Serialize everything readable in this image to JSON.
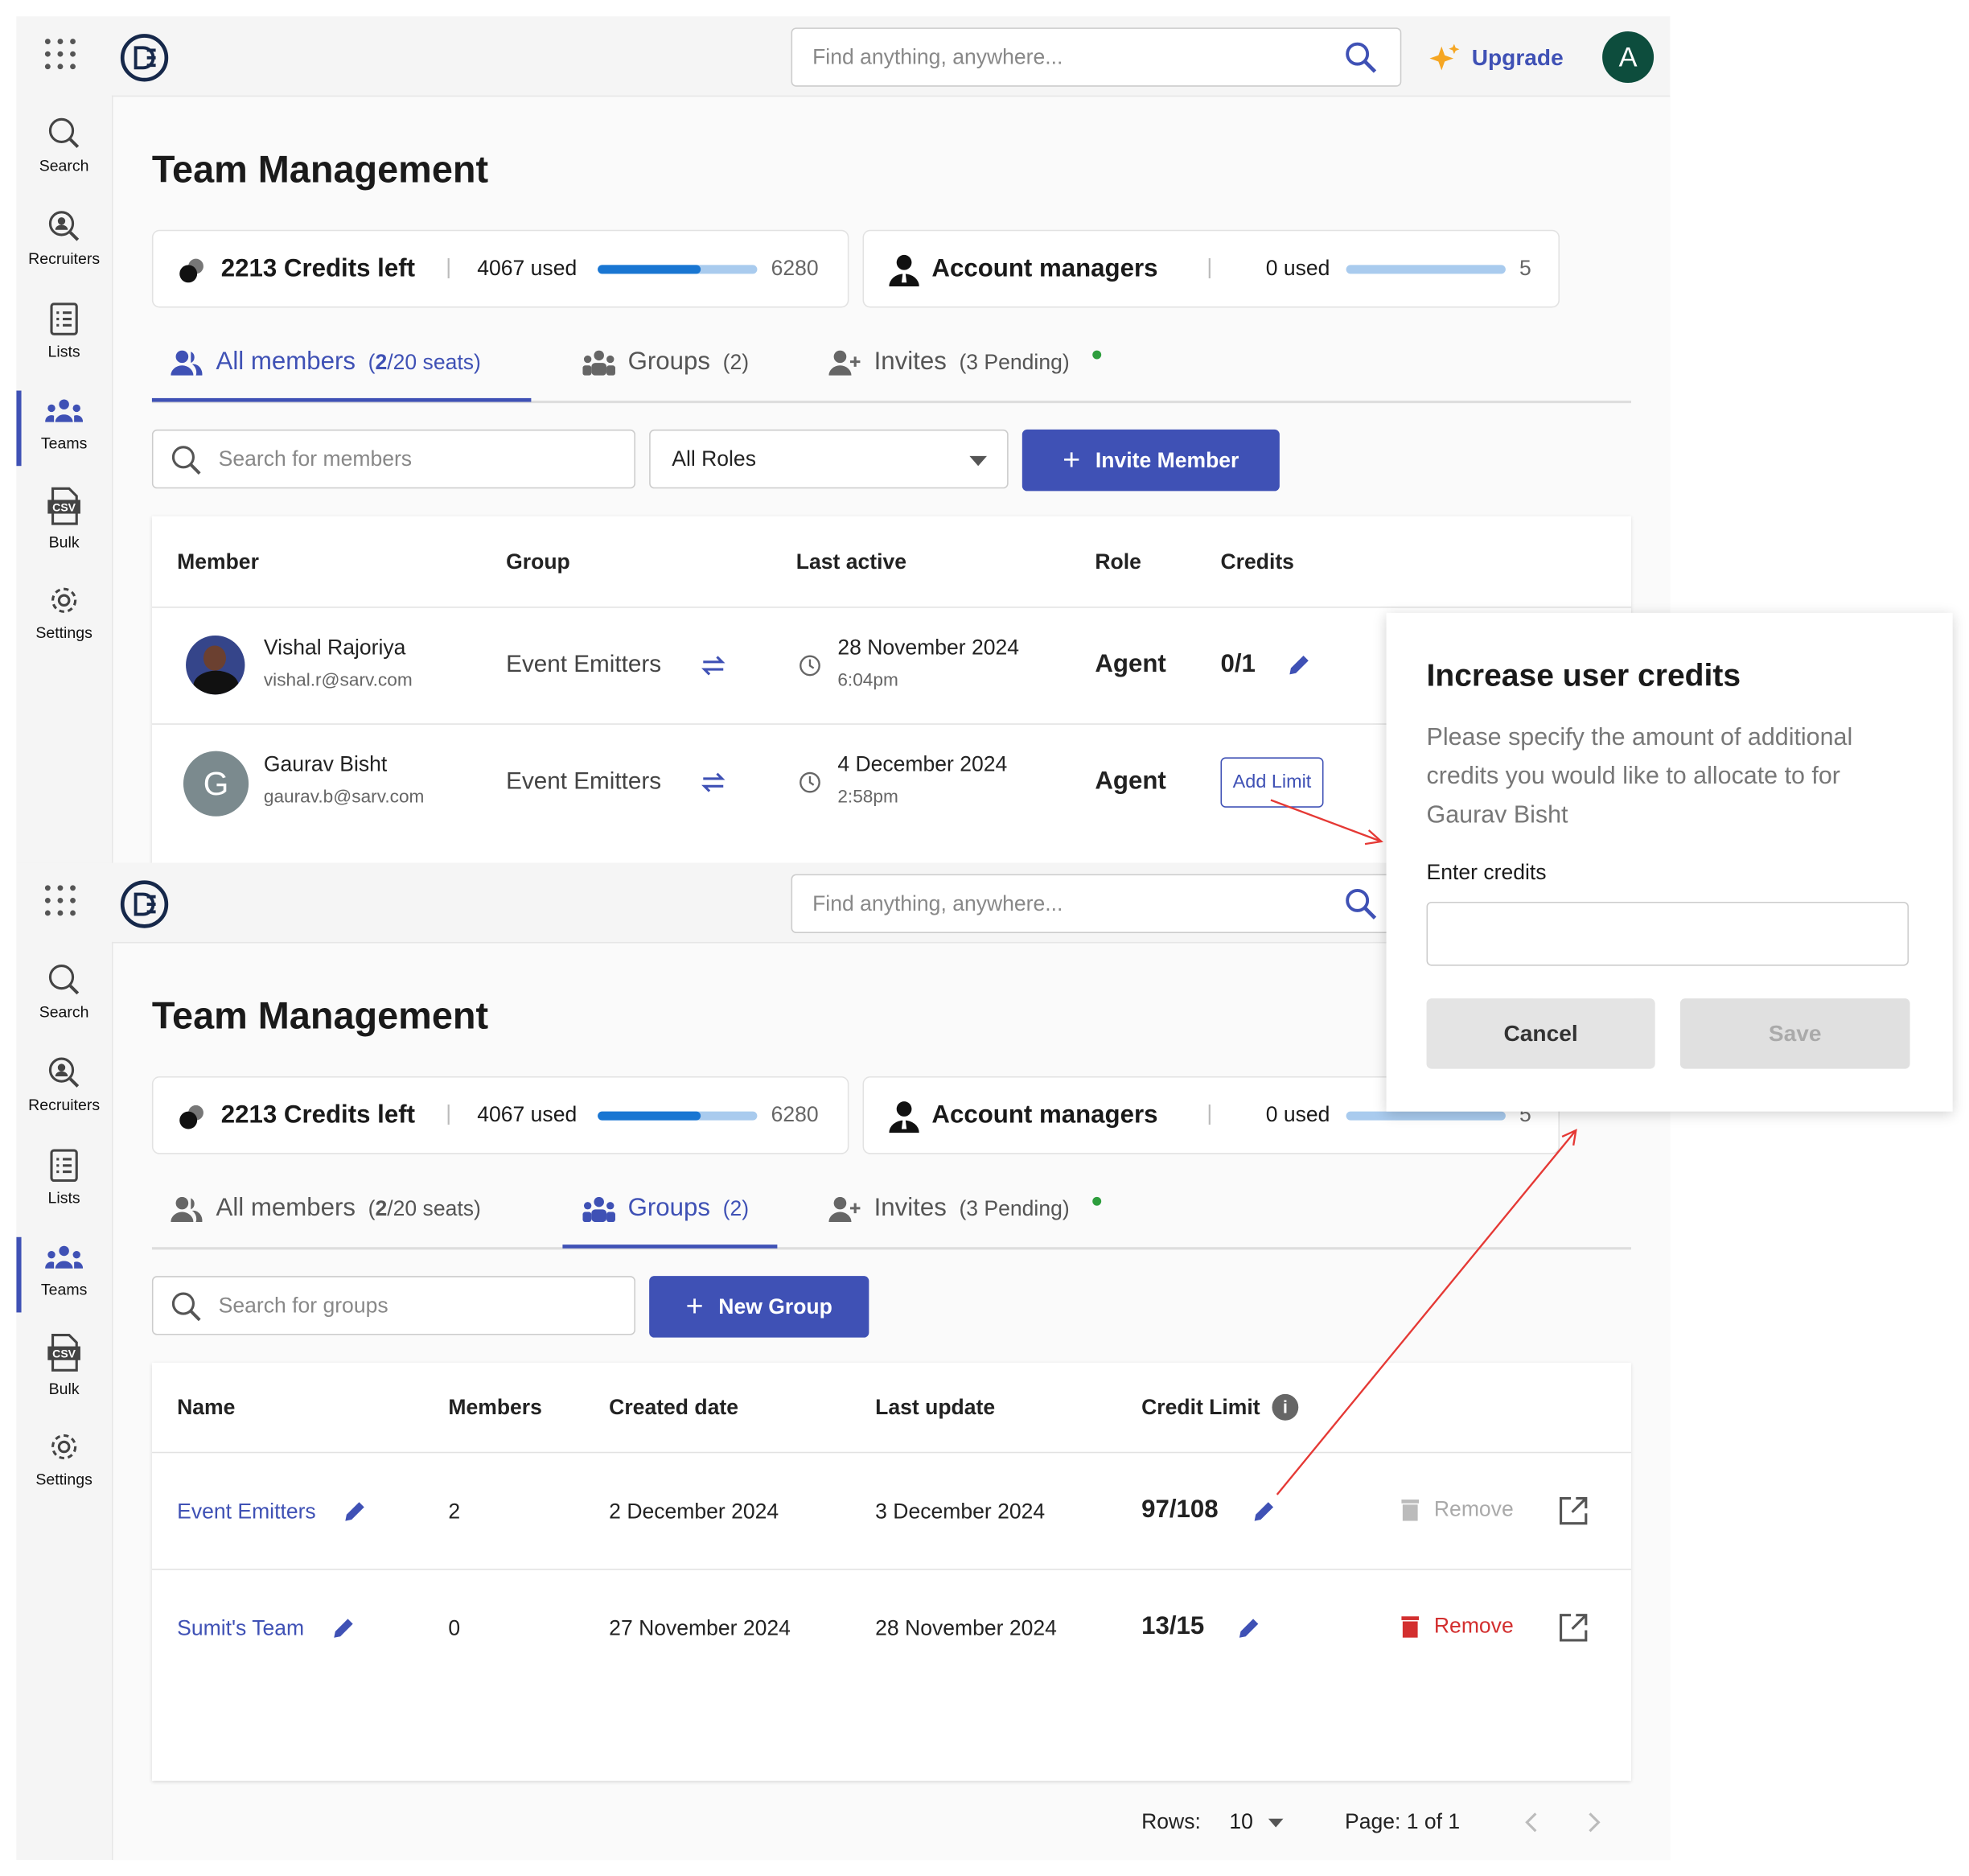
{
  "colors": {
    "accent": "#3f51b5",
    "progress": "#1976d2",
    "progress_track": "#a9cbee",
    "remove": "#d32f2f",
    "avatar": "#0d4d3d",
    "annotation_arrow": "#e53935"
  },
  "header": {
    "search_placeholder": "Find anything, anywhere...",
    "upgrade_label": "Upgrade",
    "avatar_letter": "A"
  },
  "sidebar": {
    "items": [
      {
        "label": "Search",
        "icon": "search-icon"
      },
      {
        "label": "Recruiters",
        "icon": "recruiter-search-icon"
      },
      {
        "label": "Lists",
        "icon": "list-icon"
      },
      {
        "label": "Teams",
        "icon": "teams-icon",
        "active": true
      },
      {
        "label": "Bulk",
        "icon": "csv-file-icon"
      },
      {
        "label": "Settings",
        "icon": "gear-icon"
      }
    ]
  },
  "page_title": "Team Management",
  "credits_card": {
    "left_label": "2213 Credits left",
    "used_label": "4067 used",
    "total": "6280",
    "used_fraction": 0.648
  },
  "managers_card": {
    "label": "Account managers",
    "used_label": "0 used",
    "total": "5",
    "used_fraction": 0
  },
  "tabs": [
    {
      "label": "All members",
      "count_bold": "2",
      "count_rest": "/20 seats)",
      "count_open": "("
    },
    {
      "label": "Groups",
      "count": "(2)"
    },
    {
      "label": "Invites",
      "count": "(3 Pending)"
    }
  ],
  "members_view": {
    "search_placeholder": "Search for members",
    "roles_select": "All Roles",
    "invite_button": "Invite Member",
    "columns": [
      "Member",
      "Group",
      "Last active",
      "Role",
      "Credits"
    ],
    "rows": [
      {
        "name": "Vishal Rajoriya",
        "email": "vishal.r@sarv.com",
        "group": "Event Emitters",
        "date": "28 November 2024",
        "time": "6:04pm",
        "role": "Agent",
        "credits": "0/1"
      },
      {
        "name": "Gaurav Bisht",
        "email": "gaurav.b@sarv.com",
        "initial": "G",
        "group": "Event Emitters",
        "date": "4 December 2024",
        "time": "2:58pm",
        "role": "Agent",
        "credits_button": "Add Limit"
      }
    ]
  },
  "groups_view": {
    "search_placeholder": "Search for groups",
    "new_button": "New Group",
    "columns": [
      "Name",
      "Members",
      "Created date",
      "Last update",
      "Credit Limit"
    ],
    "rows": [
      {
        "name": "Event Emitters",
        "members": "2",
        "created": "2 December 2024",
        "updated": "3 December 2024",
        "limit": "97/108",
        "remove": "Remove",
        "remove_enabled": false
      },
      {
        "name": "Sumit's Team",
        "members": "0",
        "created": "27 November 2024",
        "updated": "28 November 2024",
        "limit": "13/15",
        "remove": "Remove",
        "remove_enabled": true
      }
    ],
    "pagination": {
      "rows_label": "Rows:",
      "rows_value": "10",
      "page_label": "Page: 1 of 1"
    }
  },
  "dialog": {
    "title": "Increase user credits",
    "description": "Please specify the amount of additional credits you would like to allocate to for Gaurav Bisht",
    "input_label": "Enter credits",
    "input_value": "",
    "cancel": "Cancel",
    "save": "Save"
  }
}
